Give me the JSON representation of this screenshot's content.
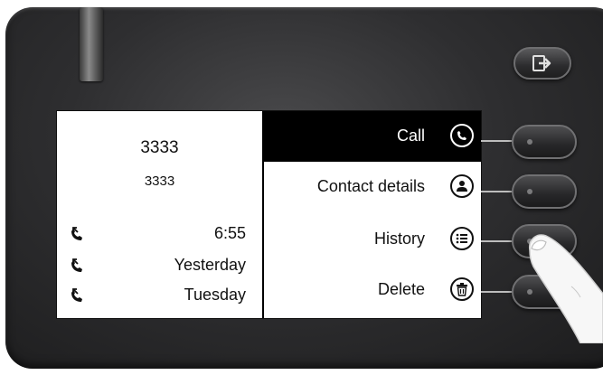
{
  "colors": {
    "selected_bg": "#000000",
    "screen_bg": "#ffffff",
    "phone_body": "#2e2e30"
  },
  "device": {
    "top_button": {
      "icon": "exit-arrow-icon"
    }
  },
  "screen": {
    "caller": {
      "name": "3333",
      "number": "3333"
    },
    "history": [
      {
        "icon": "incoming-call-icon",
        "time": "6:55"
      },
      {
        "icon": "incoming-call-icon",
        "time": "Yesterday"
      },
      {
        "icon": "incoming-call-icon",
        "time": "Tuesday"
      }
    ],
    "menu": [
      {
        "label": "Call",
        "icon": "phone-icon",
        "selected": true
      },
      {
        "label": "Contact details",
        "icon": "person-icon",
        "selected": false
      },
      {
        "label": "History",
        "icon": "list-icon",
        "selected": false
      },
      {
        "label": "Delete",
        "icon": "trash-icon",
        "selected": false
      }
    ]
  }
}
